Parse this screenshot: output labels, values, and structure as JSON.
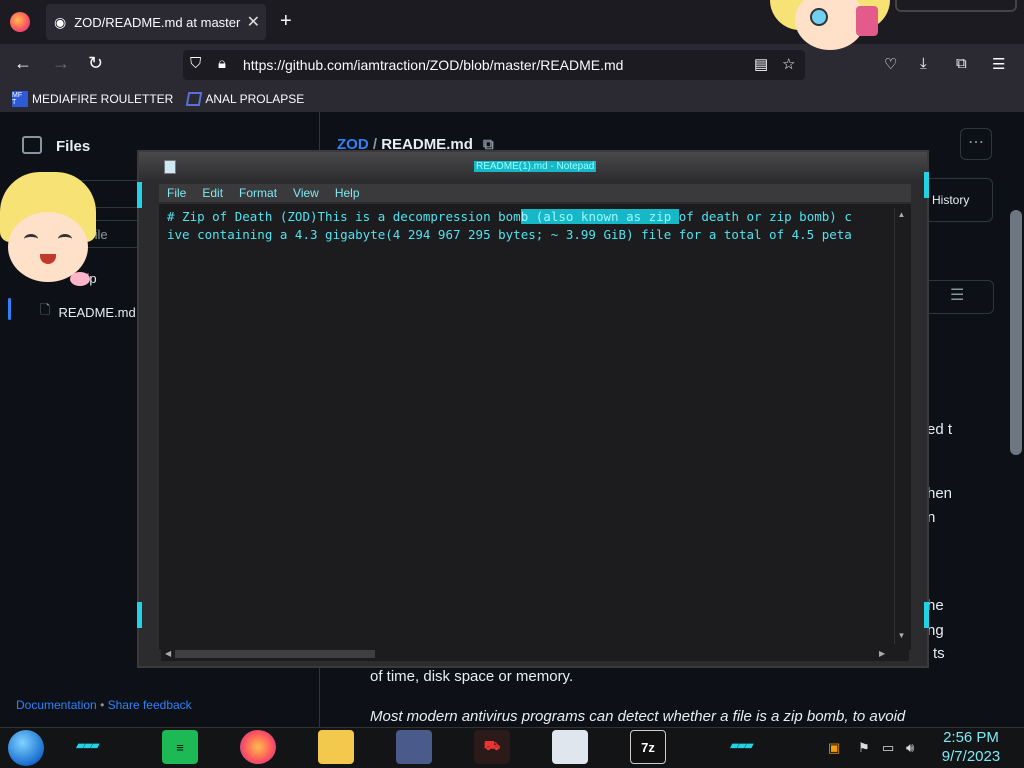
{
  "browser": {
    "tab_title": "ZOD/README.md at master · ia",
    "tab_close": "✕",
    "new_tab": "+",
    "url": "https://github.com/iamtraction/ZOD/blob/master/README.md",
    "bookmarks": [
      {
        "label": "MEDIAFIRE ROULETTER",
        "icon_text": "MF T"
      },
      {
        "label": "ANAL PROLAPSE"
      }
    ]
  },
  "github": {
    "sidebar_title": "Files",
    "filter_fragment": "ter",
    "file_fragment": "file",
    "zip_fragment": "zip",
    "readme_item": "README.md",
    "footer_doc": "Documentation",
    "footer_sep": "•",
    "footer_feedback": "Share feedback",
    "breadcrumb_repo": "ZOD",
    "breadcrumb_sep": "/",
    "breadcrumb_file": "README.md",
    "history_fragment": "History",
    "right_fragments": [
      "ed t",
      "hen",
      "n",
      "he",
      "ng",
      "ts"
    ],
    "para1": "of time, disk space or memory.",
    "para2": "Most modern antivirus programs can detect whether a file is a zip bomb, to avoid"
  },
  "notepad": {
    "title": "README(1).md - Notepad",
    "menu": [
      "File",
      "Edit",
      "Format",
      "View",
      "Help"
    ],
    "line1_before": "# Zip of Death (ZOD)This is a decompression bom",
    "line1_selected": "b (also known as zip ",
    "line1_after": "of death or zip bomb) c",
    "line2": "ive containing a 4.3 gigabyte(4 294 967 295 bytes; ~ 3.99 GiB) file for a total of 4.5 peta"
  },
  "taskbar": {
    "apps": [
      "spotify-icon",
      "firefox-icon",
      "file-explorer-icon",
      "window-icon",
      "racing-game-icon",
      "network-folder-icon",
      "7zip-icon"
    ],
    "seven_zip_label": "7z",
    "time": "2:56 PM",
    "date": "9/7/2023"
  },
  "colors": {
    "accent": "#22d3e6",
    "github_link": "#2f81f7",
    "notepad_text": "#4fe3f0"
  }
}
